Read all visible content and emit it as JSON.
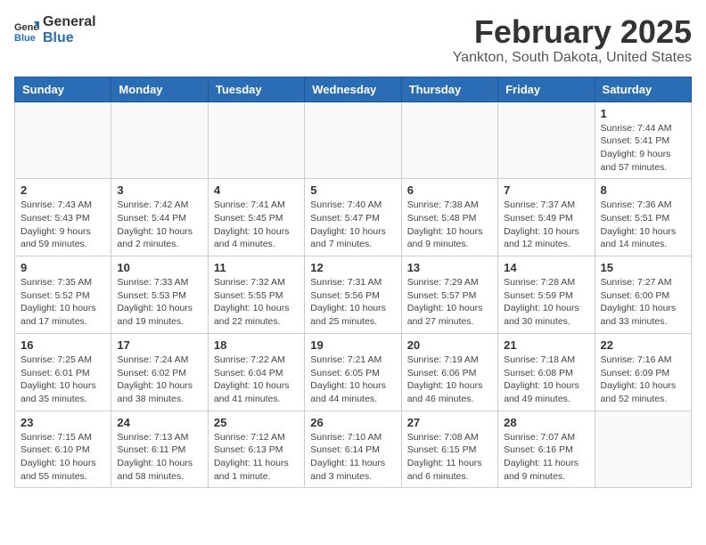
{
  "logo": {
    "general": "General",
    "blue": "Blue"
  },
  "title": "February 2025",
  "location": "Yankton, South Dakota, United States",
  "weekdays": [
    "Sunday",
    "Monday",
    "Tuesday",
    "Wednesday",
    "Thursday",
    "Friday",
    "Saturday"
  ],
  "weeks": [
    [
      {
        "day": "",
        "info": ""
      },
      {
        "day": "",
        "info": ""
      },
      {
        "day": "",
        "info": ""
      },
      {
        "day": "",
        "info": ""
      },
      {
        "day": "",
        "info": ""
      },
      {
        "day": "",
        "info": ""
      },
      {
        "day": "1",
        "info": "Sunrise: 7:44 AM\nSunset: 5:41 PM\nDaylight: 9 hours and 57 minutes."
      }
    ],
    [
      {
        "day": "2",
        "info": "Sunrise: 7:43 AM\nSunset: 5:43 PM\nDaylight: 9 hours and 59 minutes."
      },
      {
        "day": "3",
        "info": "Sunrise: 7:42 AM\nSunset: 5:44 PM\nDaylight: 10 hours and 2 minutes."
      },
      {
        "day": "4",
        "info": "Sunrise: 7:41 AM\nSunset: 5:45 PM\nDaylight: 10 hours and 4 minutes."
      },
      {
        "day": "5",
        "info": "Sunrise: 7:40 AM\nSunset: 5:47 PM\nDaylight: 10 hours and 7 minutes."
      },
      {
        "day": "6",
        "info": "Sunrise: 7:38 AM\nSunset: 5:48 PM\nDaylight: 10 hours and 9 minutes."
      },
      {
        "day": "7",
        "info": "Sunrise: 7:37 AM\nSunset: 5:49 PM\nDaylight: 10 hours and 12 minutes."
      },
      {
        "day": "8",
        "info": "Sunrise: 7:36 AM\nSunset: 5:51 PM\nDaylight: 10 hours and 14 minutes."
      }
    ],
    [
      {
        "day": "9",
        "info": "Sunrise: 7:35 AM\nSunset: 5:52 PM\nDaylight: 10 hours and 17 minutes."
      },
      {
        "day": "10",
        "info": "Sunrise: 7:33 AM\nSunset: 5:53 PM\nDaylight: 10 hours and 19 minutes."
      },
      {
        "day": "11",
        "info": "Sunrise: 7:32 AM\nSunset: 5:55 PM\nDaylight: 10 hours and 22 minutes."
      },
      {
        "day": "12",
        "info": "Sunrise: 7:31 AM\nSunset: 5:56 PM\nDaylight: 10 hours and 25 minutes."
      },
      {
        "day": "13",
        "info": "Sunrise: 7:29 AM\nSunset: 5:57 PM\nDaylight: 10 hours and 27 minutes."
      },
      {
        "day": "14",
        "info": "Sunrise: 7:28 AM\nSunset: 5:59 PM\nDaylight: 10 hours and 30 minutes."
      },
      {
        "day": "15",
        "info": "Sunrise: 7:27 AM\nSunset: 6:00 PM\nDaylight: 10 hours and 33 minutes."
      }
    ],
    [
      {
        "day": "16",
        "info": "Sunrise: 7:25 AM\nSunset: 6:01 PM\nDaylight: 10 hours and 35 minutes."
      },
      {
        "day": "17",
        "info": "Sunrise: 7:24 AM\nSunset: 6:02 PM\nDaylight: 10 hours and 38 minutes."
      },
      {
        "day": "18",
        "info": "Sunrise: 7:22 AM\nSunset: 6:04 PM\nDaylight: 10 hours and 41 minutes."
      },
      {
        "day": "19",
        "info": "Sunrise: 7:21 AM\nSunset: 6:05 PM\nDaylight: 10 hours and 44 minutes."
      },
      {
        "day": "20",
        "info": "Sunrise: 7:19 AM\nSunset: 6:06 PM\nDaylight: 10 hours and 46 minutes."
      },
      {
        "day": "21",
        "info": "Sunrise: 7:18 AM\nSunset: 6:08 PM\nDaylight: 10 hours and 49 minutes."
      },
      {
        "day": "22",
        "info": "Sunrise: 7:16 AM\nSunset: 6:09 PM\nDaylight: 10 hours and 52 minutes."
      }
    ],
    [
      {
        "day": "23",
        "info": "Sunrise: 7:15 AM\nSunset: 6:10 PM\nDaylight: 10 hours and 55 minutes."
      },
      {
        "day": "24",
        "info": "Sunrise: 7:13 AM\nSunset: 6:11 PM\nDaylight: 10 hours and 58 minutes."
      },
      {
        "day": "25",
        "info": "Sunrise: 7:12 AM\nSunset: 6:13 PM\nDaylight: 11 hours and 1 minute."
      },
      {
        "day": "26",
        "info": "Sunrise: 7:10 AM\nSunset: 6:14 PM\nDaylight: 11 hours and 3 minutes."
      },
      {
        "day": "27",
        "info": "Sunrise: 7:08 AM\nSunset: 6:15 PM\nDaylight: 11 hours and 6 minutes."
      },
      {
        "day": "28",
        "info": "Sunrise: 7:07 AM\nSunset: 6:16 PM\nDaylight: 11 hours and 9 minutes."
      },
      {
        "day": "",
        "info": ""
      }
    ]
  ]
}
